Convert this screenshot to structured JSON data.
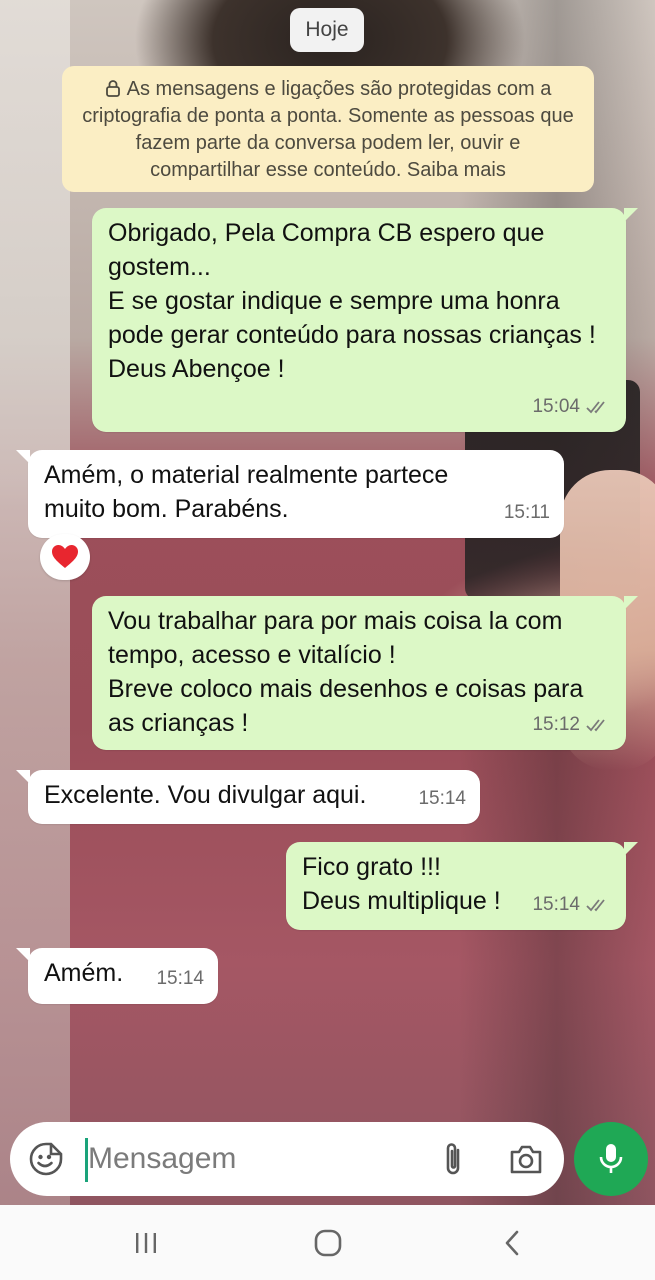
{
  "date_chip": "Hoje",
  "encryption_notice": "As mensagens e ligações são protegidas com a criptografia de ponta a ponta. Somente as pessoas que fazem parte da conversa podem ler, ouvir e compartilhar esse conteúdo. Saiba mais",
  "messages": [
    {
      "direction": "outgoing",
      "text": "Obrigado, Pela Compra CB espero que gostem...\nE se gostar indique e sempre uma honra pode gerar conteúdo para nossas crianças !\nDeus Abençoe !",
      "time": "15:04",
      "status": "read"
    },
    {
      "direction": "incoming",
      "text": "Amém, o material realmente partece muito bom. Parabéns.",
      "time": "15:11",
      "reaction": "❤️"
    },
    {
      "direction": "outgoing",
      "text": "Vou trabalhar para por mais coisa la com tempo, acesso e vitalício !\nBreve coloco mais desenhos e coisas para as crianças !",
      "time": "15:12",
      "status": "read"
    },
    {
      "direction": "incoming",
      "text": "Excelente. Vou divulgar aqui.",
      "time": "15:14"
    },
    {
      "direction": "outgoing",
      "text": "Fico grato !!!\nDeus multiplique !",
      "time": "15:14",
      "status": "read"
    },
    {
      "direction": "incoming",
      "text": "Amém.",
      "time": "15:14"
    }
  ],
  "composer": {
    "placeholder": "Mensagem"
  },
  "colors": {
    "outgoing_bubble": "#dcf8c6",
    "incoming_bubble": "#ffffff",
    "notice_bg": "#fbeec4",
    "mic_button": "#1fa855"
  },
  "icons": {
    "emoji": "emoji-icon",
    "attach": "paperclip-icon",
    "camera": "camera-icon",
    "mic": "microphone-icon",
    "lock": "lock-icon",
    "read_receipt": "double-check-icon",
    "nav_recents": "recents-icon",
    "nav_home": "home-icon",
    "nav_back": "back-icon"
  }
}
